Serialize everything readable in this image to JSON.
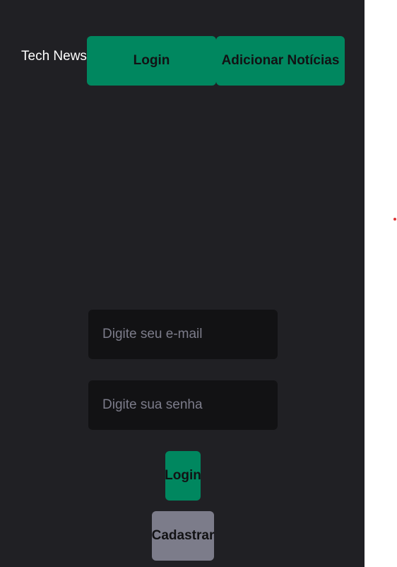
{
  "header": {
    "brand": "Tech News",
    "login_label": "Login",
    "add_news_label": "Adicionar Notícias"
  },
  "login_form": {
    "email_placeholder": "Digite seu e-mail",
    "password_placeholder": "Digite sua senha",
    "submit_label": "Login",
    "register_label": "Cadastrar"
  },
  "colors": {
    "background": "#202024",
    "input_background": "#121214",
    "primary": "#00875f",
    "secondary": "#7c7c8a",
    "page": "#ffffff"
  }
}
